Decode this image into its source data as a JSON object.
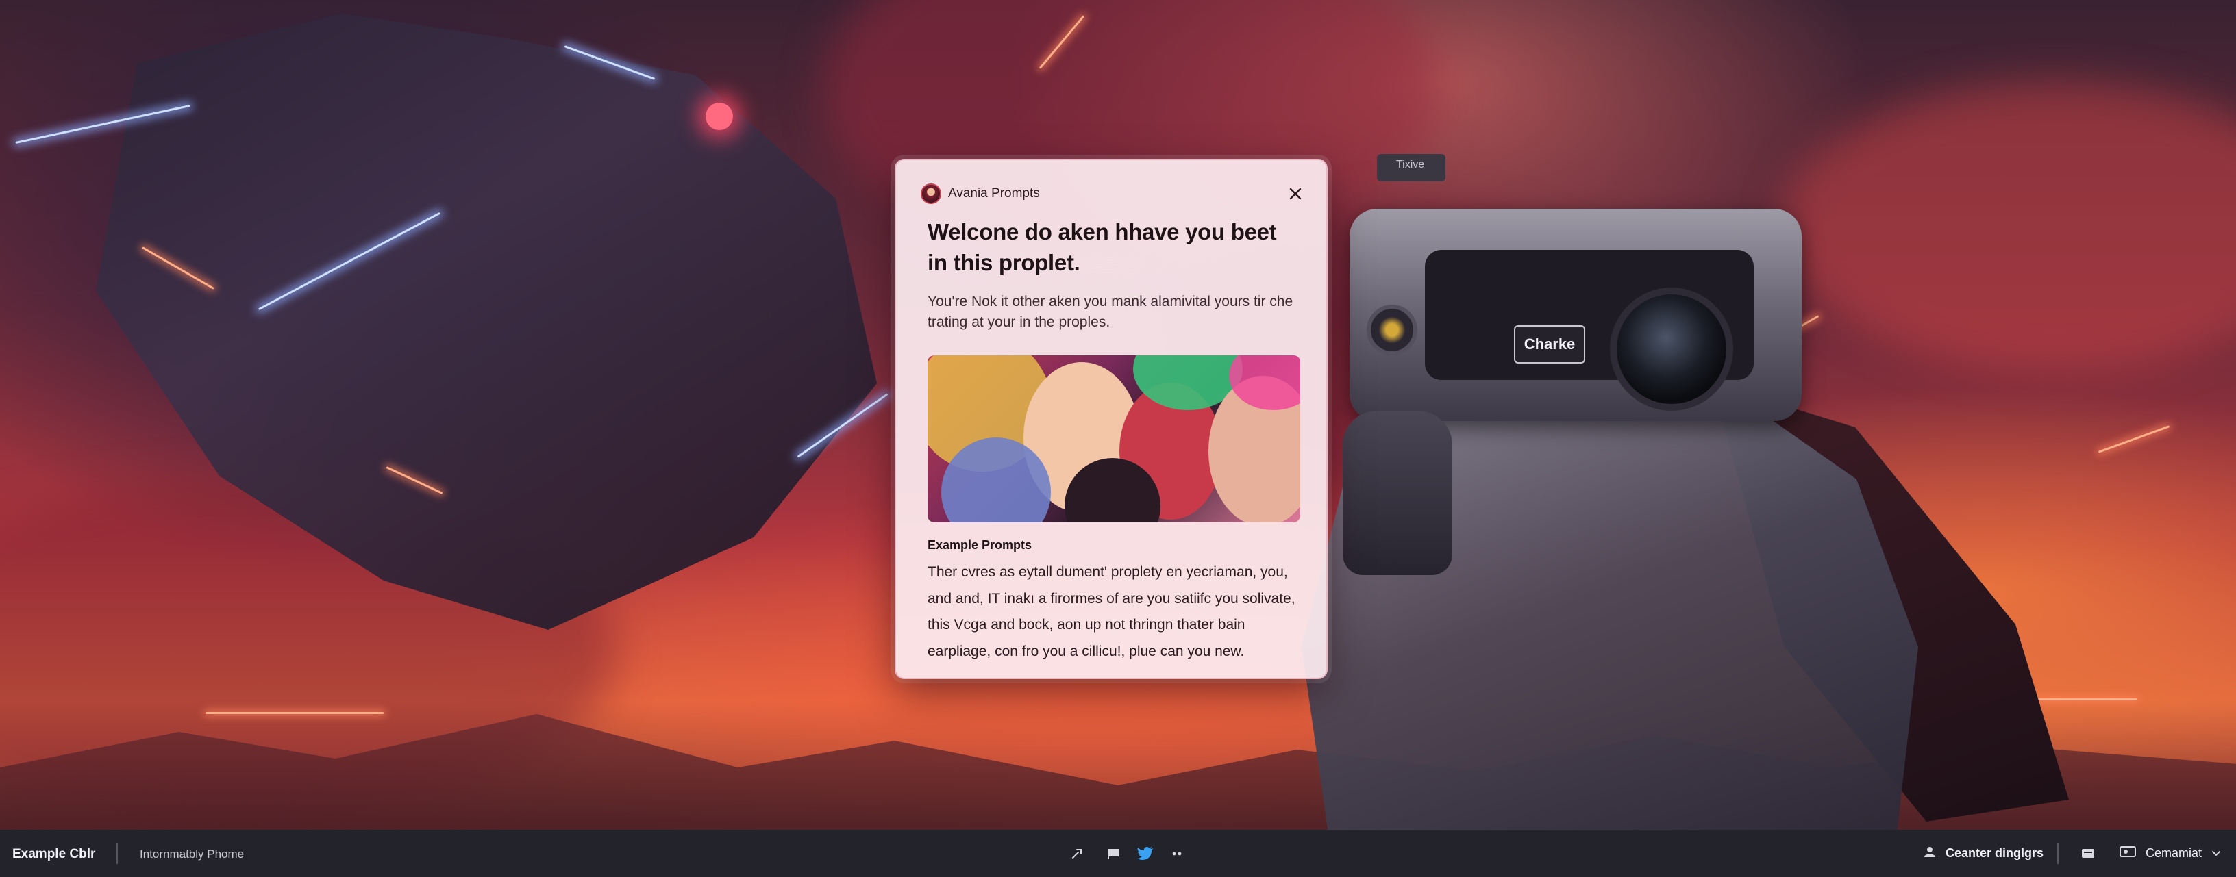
{
  "dialog": {
    "brand": "Avania Prompts",
    "title": "Welcone do aken hhave you beet in this proplet.",
    "subtitle": "You're Nok it other aken you mank alamivital yours tir che trating at your in the proples.",
    "caption": "Example Prompts",
    "body": "Ther cvres as eytall dument' proplety en yecriaman, you, and and, IT inakı a firormes of are you satiifc you solivate, this Vcga and bock, aon up not thringn thater bain earpliage, con fro you a cillicu!, plue can you new."
  },
  "robot": {
    "tag": "Charke",
    "top_label": "Tixive"
  },
  "taskbar": {
    "left_name": "Example Cblr",
    "left_sub": "Intornmatbly Phome",
    "right_user": "Ceanter dinglgrs",
    "right_account": "Cemamiat"
  },
  "icons": {
    "close": "close-icon",
    "taskbar_center": [
      "tool-icon",
      "flag-icon",
      "twitter-bird-icon",
      "more-dots-icon"
    ],
    "user": "user-icon",
    "message": "message-icon",
    "account": "account-card-icon",
    "chevron": "chevron-down-icon"
  },
  "colors": {
    "dialog_bg": "#fcecf0",
    "dialog_border": "#e8b8c4",
    "taskbar_bg": "#22232b",
    "twitter_blue": "#3aa0f0"
  }
}
